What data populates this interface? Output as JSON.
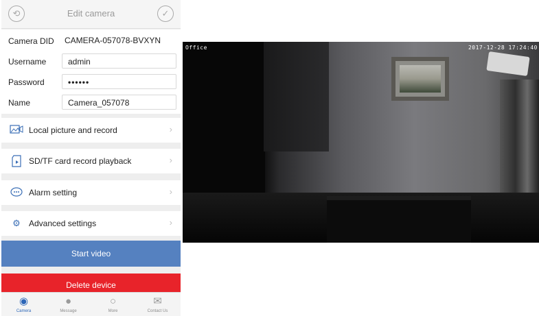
{
  "header": {
    "title": "Edit camera",
    "back_icon": "camera-back-icon",
    "confirm_icon": "check-icon"
  },
  "form": {
    "did_label": "Camera DID",
    "did_value": "CAMERA-057078-BVXYN",
    "username_label": "Username",
    "username_value": "admin",
    "password_label": "Password",
    "password_value": "••••••",
    "name_label": "Name",
    "name_value": "Camera_057078"
  },
  "menu": [
    {
      "label": "Local picture and record",
      "icon": "picture-icon"
    },
    {
      "label": "SD/TF card record playback",
      "icon": "sd-card-icon"
    },
    {
      "label": "Alarm setting",
      "icon": "alarm-icon"
    },
    {
      "label": "Advanced settings",
      "icon": "gear-icon"
    }
  ],
  "buttons": {
    "start": "Start video",
    "delete": "Delete device"
  },
  "tabs": [
    {
      "label": "Camera",
      "icon": "eye-icon",
      "active": true
    },
    {
      "label": "Message",
      "icon": "chat-icon",
      "active": false
    },
    {
      "label": "More",
      "icon": "more-icon",
      "active": false
    },
    {
      "label": "Contact Us",
      "icon": "envelope-icon",
      "active": false
    }
  ],
  "video": {
    "location_label": "Office",
    "timestamp": "2017-12-28 17:24:40"
  },
  "colors": {
    "accent": "#5581c0",
    "danger": "#e8232a",
    "active_tab": "#2c66b8"
  }
}
